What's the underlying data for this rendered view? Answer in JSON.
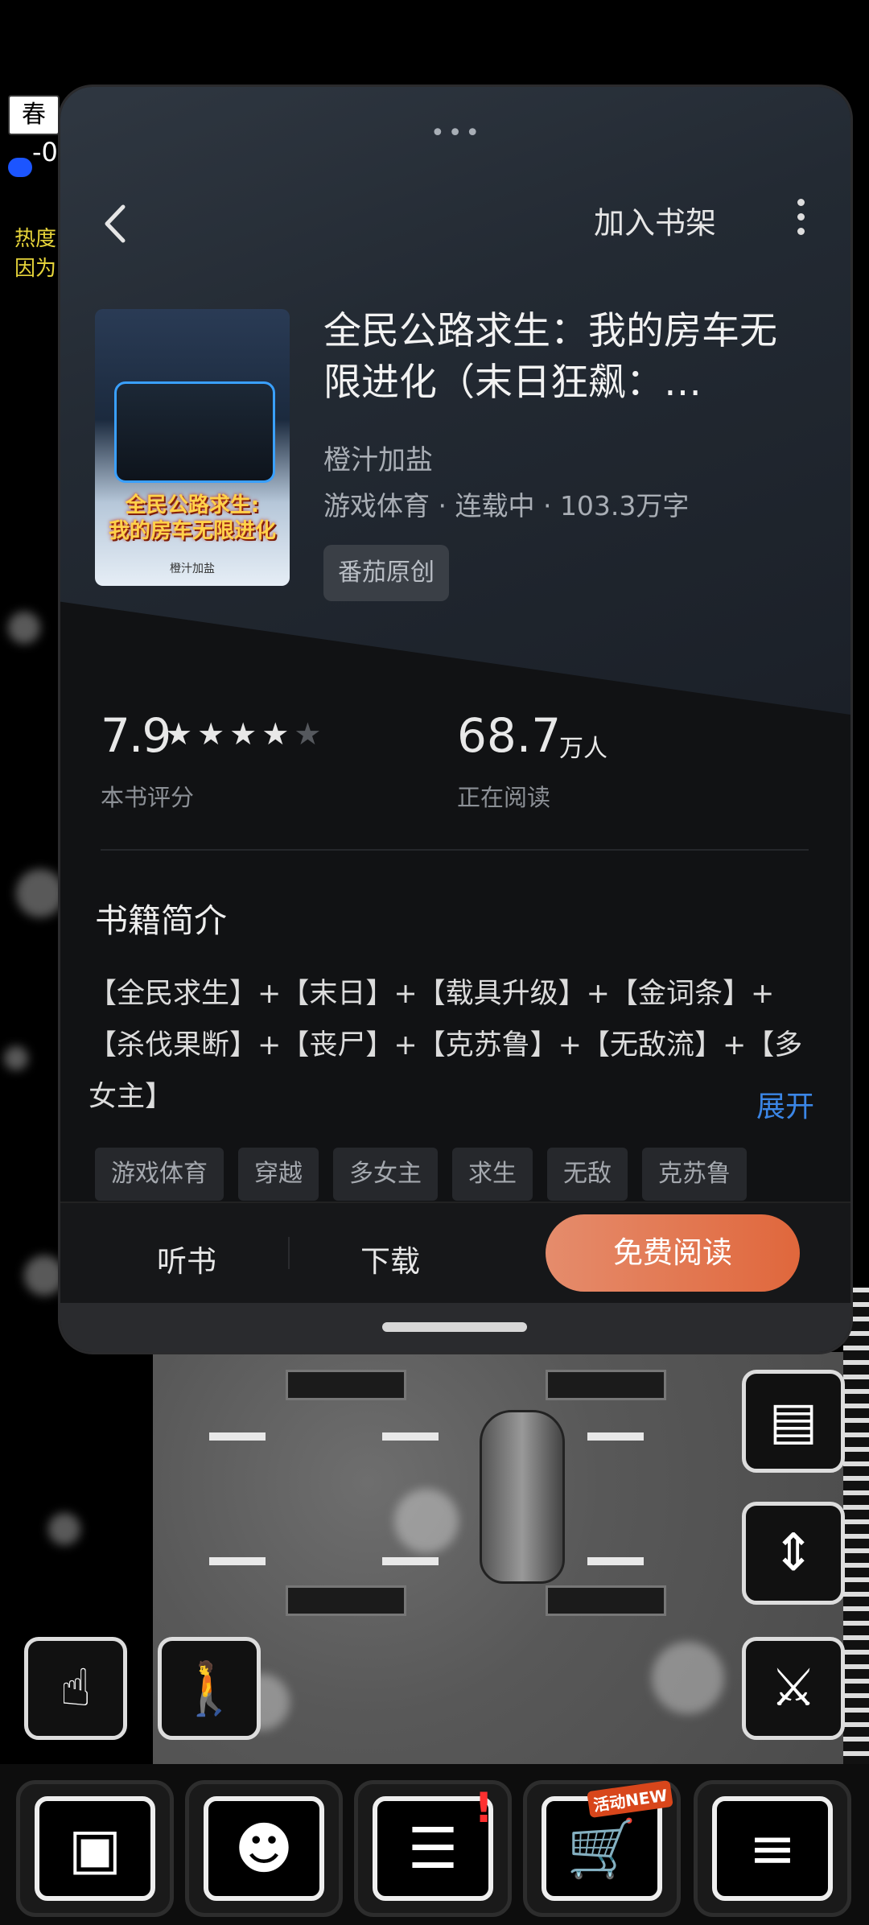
{
  "game": {
    "season": "春",
    "hud_value": "-0",
    "hud_line1": "热度",
    "hud_line2": "因为"
  },
  "book_sheet": {
    "add_shelf": "加入书架",
    "title": "全民公路求生：我的房车无限进化（末日狂飙：…",
    "author": "橙汁加盐",
    "meta": "游戏体育 · 连载中 · 103.3万字",
    "badge": "番茄原创",
    "cover": {
      "title_line1": "全民公路求生:",
      "title_line2": "我的房车无限进化",
      "author": "橙汁加盐"
    },
    "rating": {
      "value": "7.9",
      "stars_filled": 4,
      "stars_total": 5,
      "label": "本书评分"
    },
    "readers": {
      "value": "68.7",
      "unit": "万人",
      "label": "正在阅读"
    },
    "intro": {
      "heading": "书籍简介",
      "text": "【全民求生】+【末日】+【载具升级】+【金词条】+【杀伐果断】+【丧尸】+【克苏鲁】+【无敌流】+【多女主】",
      "expand": "展开"
    },
    "tags": [
      "游戏体育",
      "穿越",
      "多女主",
      "求生",
      "无敌",
      "克苏鲁"
    ],
    "actions": {
      "listen": "听书",
      "download": "下载",
      "read": "免费阅读"
    }
  },
  "bottom_bar": {
    "new_badge": "活动NEW",
    "items": [
      "chest-icon",
      "brain-icon",
      "journal-icon",
      "cart-icon",
      "menu-icon"
    ]
  }
}
